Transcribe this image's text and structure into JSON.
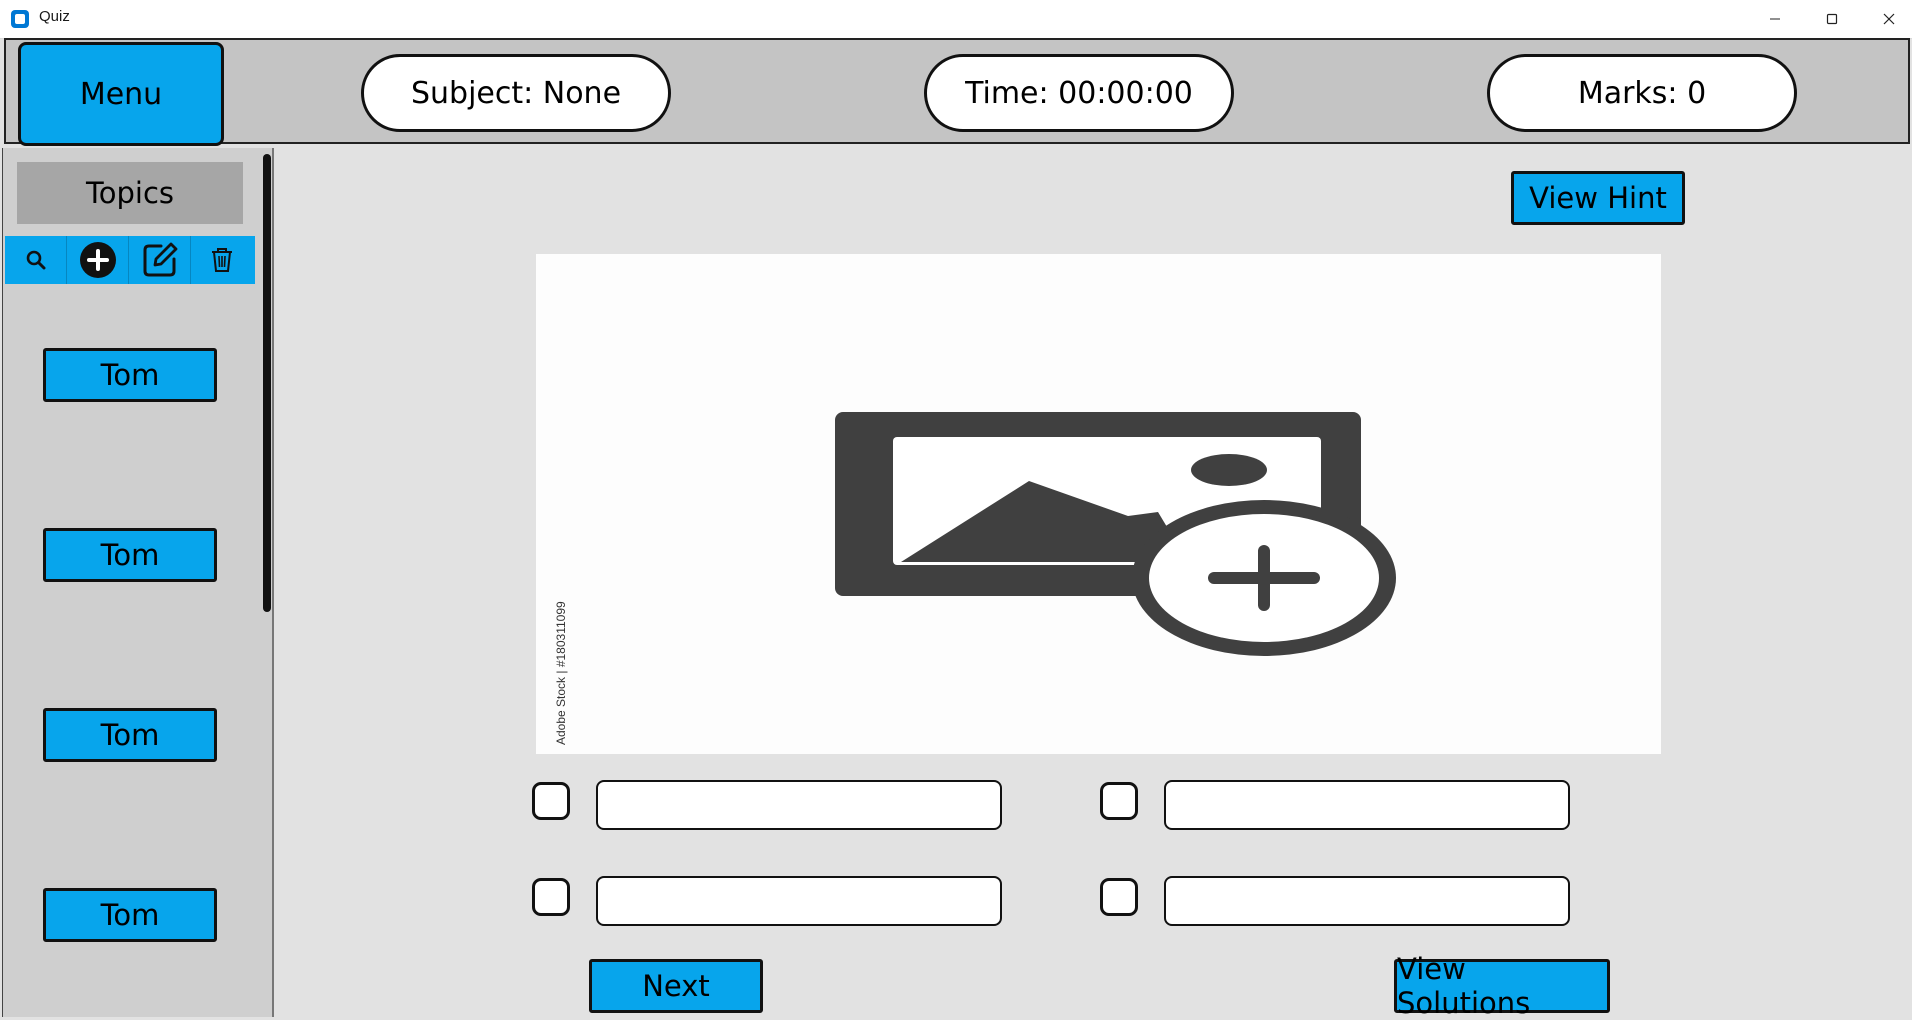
{
  "window": {
    "title": "Quiz"
  },
  "header": {
    "menu_label": "Menu",
    "subject": "Subject: None",
    "time": "Time: 00:00:00",
    "marks": "Marks: 0"
  },
  "sidebar": {
    "title": "Topics",
    "toolbar": [
      "search-icon",
      "add-circle-icon",
      "edit-icon",
      "trash-icon"
    ],
    "topics": [
      "Tom",
      "Tom",
      "Tom",
      "Tom"
    ]
  },
  "main": {
    "view_hint_label": "View Hint",
    "image_caption": "Adobe Stock | #180311099",
    "options": [
      {
        "value": ""
      },
      {
        "value": ""
      },
      {
        "value": ""
      },
      {
        "value": ""
      }
    ],
    "next_label": "Next",
    "view_solutions_label": "View Solutions"
  },
  "colors": {
    "accent": "#07a5ec",
    "header_bg": "#c4c4c4",
    "sidebar_bg": "#cfcfcf",
    "content_bg": "#e2e2e2"
  }
}
